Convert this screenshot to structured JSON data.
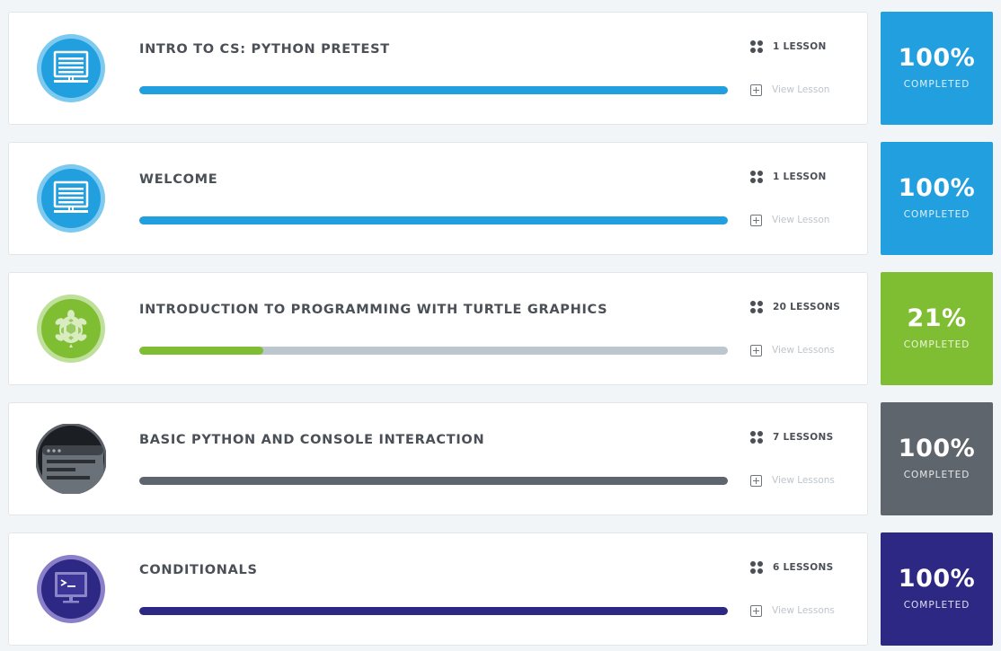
{
  "modules": [
    {
      "title": "INTRO TO CS: PYTHON PRETEST",
      "lesson_count": "1 LESSON",
      "view_label": "View Lesson",
      "percent": "100%",
      "completed_label": "COMPLETED",
      "progress": 1.0,
      "color": "#229fde",
      "icon": "monitor-icon"
    },
    {
      "title": "WELCOME",
      "lesson_count": "1 LESSON",
      "view_label": "View Lesson",
      "percent": "100%",
      "completed_label": "COMPLETED",
      "progress": 1.0,
      "color": "#229fde",
      "icon": "monitor-icon"
    },
    {
      "title": "INTRODUCTION TO PROGRAMMING WITH TURTLE GRAPHICS",
      "lesson_count": "20 LESSONS",
      "view_label": "View Lessons",
      "percent": "21%",
      "completed_label": "COMPLETED",
      "progress": 0.21,
      "color": "#7fbe32",
      "icon": "turtle-icon"
    },
    {
      "title": "BASIC PYTHON AND CONSOLE INTERACTION",
      "lesson_count": "7 LESSONS",
      "view_label": "View Lessons",
      "percent": "100%",
      "completed_label": "COMPLETED",
      "progress": 1.0,
      "color": "#5f656d",
      "icon": "console-window-icon"
    },
    {
      "title": "CONDITIONALS",
      "lesson_count": "6 LESSONS",
      "view_label": "View Lessons",
      "percent": "100%",
      "completed_label": "COMPLETED",
      "progress": 1.0,
      "color": "#2c2883",
      "icon": "terminal-icon"
    }
  ],
  "colors": {
    "track": "#bcc6cf",
    "card_border": "#e1e6eb",
    "background": "#f2f5f8",
    "text": "#4b4f56"
  }
}
